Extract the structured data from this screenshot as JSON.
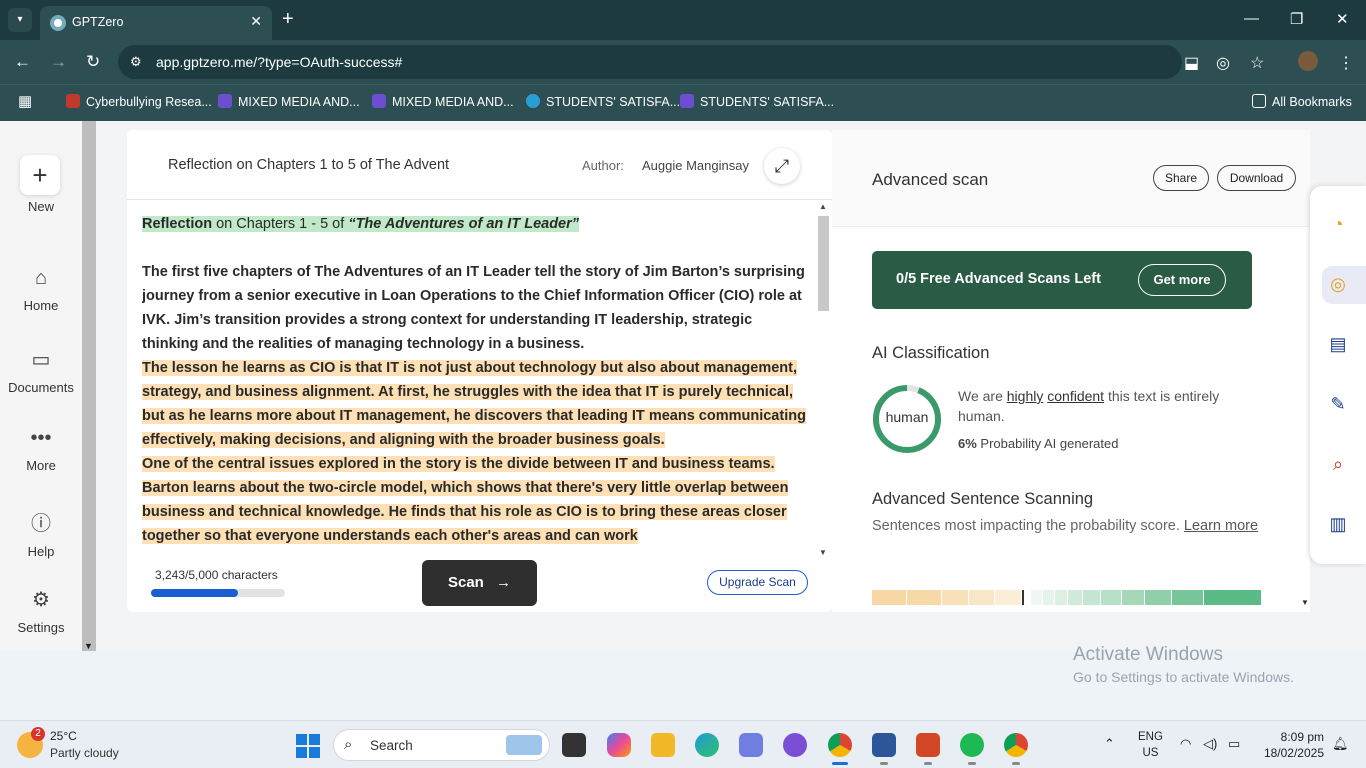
{
  "browser": {
    "tab_title": "GPTZero",
    "url": "app.gptzero.me/?type=OAuth-success#",
    "bookmarks": [
      {
        "label": "Cyberbullying Resea...",
        "color": "#c0392b"
      },
      {
        "label": "MIXED MEDIA AND...",
        "color": "#6c4fd1"
      },
      {
        "label": "MIXED MEDIA AND...",
        "color": "#6c4fd1"
      },
      {
        "label": "STUDENTS' SATISFA...",
        "color": "#2a9fd6"
      },
      {
        "label": "STUDENTS' SATISFA...",
        "color": "#6c4fd1"
      }
    ],
    "all_bookmarks": "All Bookmarks"
  },
  "sidebar": {
    "new_label": "New",
    "items": [
      {
        "label": "Home",
        "icon": "home-icon"
      },
      {
        "label": "Documents",
        "icon": "folder-icon"
      },
      {
        "label": "More",
        "icon": "more-icon"
      },
      {
        "label": "Help",
        "icon": "help-icon"
      },
      {
        "label": "Settings",
        "icon": "gear-icon"
      }
    ]
  },
  "editor": {
    "doc_title": "Reflection on Chapters 1 to 5 of The Advent",
    "author_label": "Author:",
    "author_name": "Auggie Manginsay",
    "heading_prefix": "Reflection",
    "heading_middle": " on Chapters 1 - 5 of ",
    "heading_book": "“The Adventures of an IT Leader”",
    "para1": "The first five chapters of The Adventures of an IT Leader tell the story of Jim Barton’s surprising journey from a senior executive in Loan Operations to the Chief Information Officer (CIO) role at IVK. Jim’s transition provides a strong context for understanding IT leadership, strategic thinking and the realities of managing technology in a business.",
    "para2": "The lesson he learns as CIO is that IT is not just about technology but also about management, strategy, and business alignment. At first, he struggles with the idea that IT is purely technical, but as he learns more about IT management, he discovers that leading IT means communicating effectively, making decisions, and aligning with the broader business goals.",
    "para3": "One of the central issues explored in the story is the divide between IT and business teams. Barton learns about the two-circle model, which shows that there's very little overlap between business and technical knowledge. He finds that his role as CIO is to bring these areas closer together so that everyone understands each other's areas and can work",
    "char_count": "3,243/5,000 characters",
    "char_fraction": 0.6486,
    "scan_label": "Scan",
    "upgrade_label": "Upgrade Scan"
  },
  "results": {
    "title": "Advanced scan",
    "share_label": "Share",
    "download_label": "Download",
    "promo_text": "0/5 Free Advanced Scans Left",
    "get_more_label": "Get more",
    "ai_class_title": "AI Classification",
    "ring_label": "human",
    "human_fraction": 0.94,
    "conf_pre": "We are ",
    "conf_highly": "highly",
    "conf_confident": "confident",
    "conf_post": " this text is entirely human.",
    "prob_value": "6%",
    "prob_label": " Probability AI generated",
    "sentence_title": "Advanced Sentence Scanning",
    "sentence_desc": "Sentences most impacting the probability score. ",
    "learn_more": "Learn more"
  },
  "colors": {
    "accent_green": "#2a5b45",
    "human_ring": "#3b9a6a",
    "highlight_orange": "#fde0b5",
    "highlight_green": "#bfe9c9"
  },
  "overlay": {
    "activate_title": "Activate Windows",
    "activate_sub": "Go to Settings to activate Windows."
  },
  "taskbar": {
    "weather_badge": "2",
    "temperature": "25°C",
    "weather_desc": "Partly cloudy",
    "search_placeholder": "Search",
    "lang_1": "ENG",
    "lang_2": "US",
    "time": "8:09 pm",
    "date": "18/02/2025"
  }
}
